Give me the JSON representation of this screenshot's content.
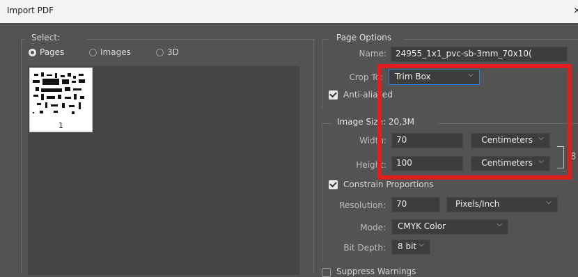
{
  "window": {
    "title": "Import PDF",
    "close_glyph": "×"
  },
  "select": {
    "label": "Select:",
    "options": [
      {
        "label": "Pages",
        "selected": true
      },
      {
        "label": "Images",
        "selected": false
      },
      {
        "label": "3D",
        "selected": false
      }
    ],
    "thumbnail_page": "1"
  },
  "page_options": {
    "group_label": "Page Options",
    "name_label": "Name:",
    "name_value": "24955_1x1_pvc-sb-3mm_70x10(",
    "crop_label": "Crop To:",
    "crop_value": "Trim Box",
    "antialiased_label": "Anti-aliased",
    "antialiased_checked": true
  },
  "image_size": {
    "group_label": "Image Size: 20,3M",
    "width_label": "Width:",
    "width_value": "70",
    "width_unit": "Centimeters",
    "height_label": "Height:",
    "height_value": "100",
    "height_unit": "Centimeters",
    "constrain_label": "Constrain Proportions",
    "constrain_checked": true,
    "resolution_label": "Resolution:",
    "resolution_value": "70",
    "resolution_unit": "Pixels/Inch",
    "mode_label": "Mode:",
    "mode_value": "CMYK Color",
    "bitdepth_label": "Bit Depth:",
    "bitdepth_value": "8 bit"
  },
  "suppress": {
    "label": "Suppress Warnings"
  },
  "colors": {
    "annotation_red": "#e21d1d",
    "focus_blue": "#2f7fd6"
  }
}
